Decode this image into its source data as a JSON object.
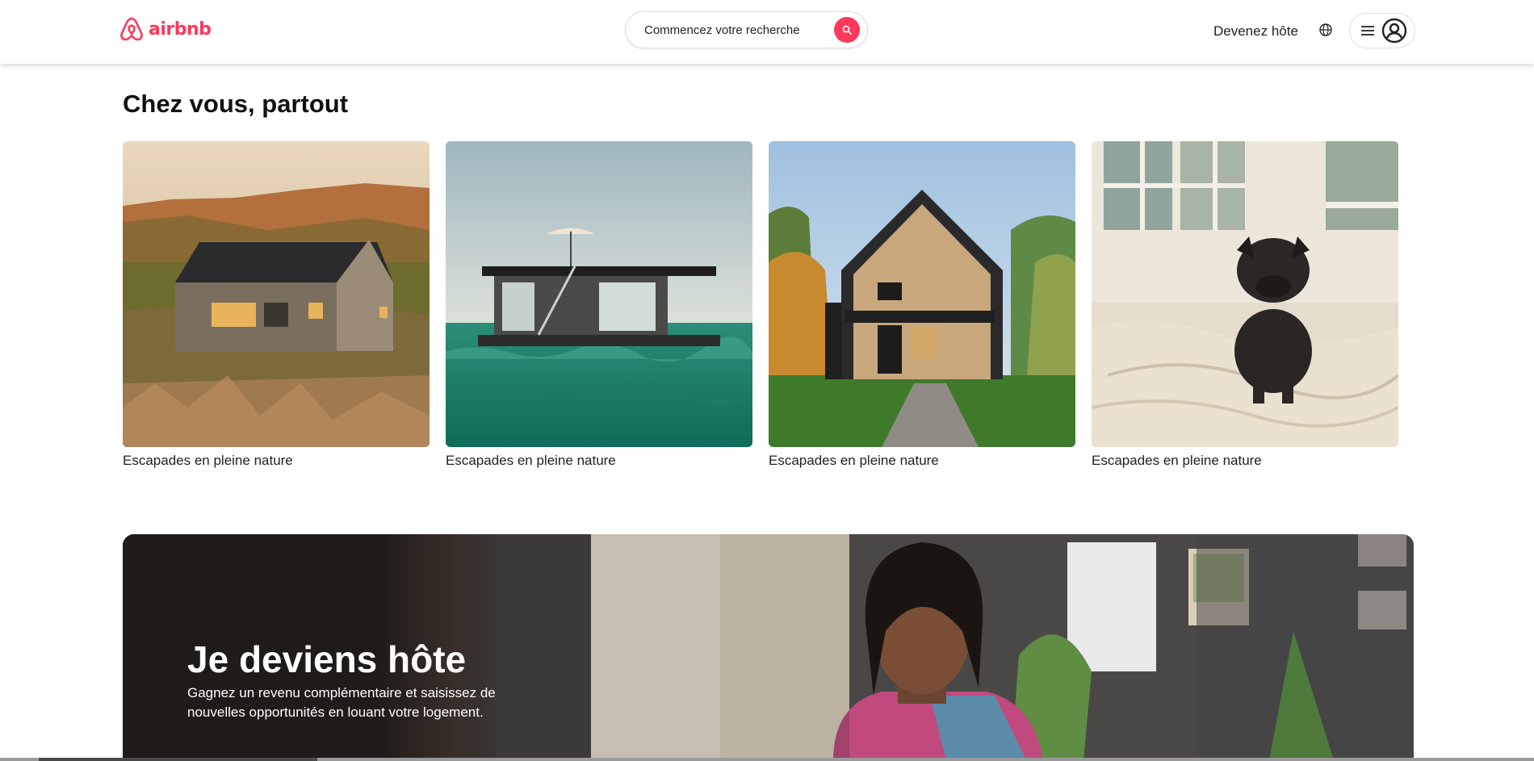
{
  "header": {
    "logo_text": "airbnb",
    "search_placeholder": "Commencez votre recherche",
    "host_link": "Devenez hôte",
    "brand_color": "#FF385C"
  },
  "section": {
    "title": "Chez vous, partout",
    "cards": [
      {
        "label": "Escapades en pleine nature",
        "image": "wooden house in hills"
      },
      {
        "label": "Escapades en pleine nature",
        "image": "houseboat on green sea"
      },
      {
        "label": "Escapades en pleine nature",
        "image": "a-frame wooden cabin"
      },
      {
        "label": "Escapades en pleine nature",
        "image": "black pug on bed"
      }
    ]
  },
  "banner": {
    "title": "Je deviens hôte",
    "description": "Gagnez un revenu complémentaire et saisissez de nouvelles opportunités en louant votre logement."
  }
}
